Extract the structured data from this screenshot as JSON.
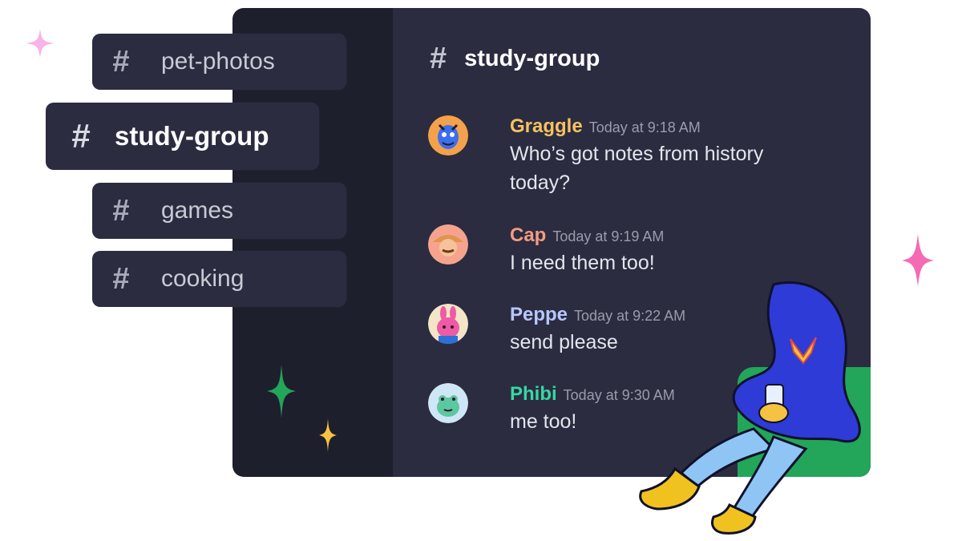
{
  "channels": [
    {
      "name": "pet-photos",
      "active": false
    },
    {
      "name": "study-group",
      "active": true
    },
    {
      "name": "games",
      "active": false
    },
    {
      "name": "cooking",
      "active": false
    }
  ],
  "header": {
    "channel": "study-group"
  },
  "messages": [
    {
      "author": "Graggle",
      "time": "Today at 9:18 AM",
      "text": "Who’s got notes from history today?",
      "color": "#f6c261"
    },
    {
      "author": "Cap",
      "time": "Today at 9:19 AM",
      "text": "I need them too!",
      "color": "#f39b84"
    },
    {
      "author": "Peppe",
      "time": "Today at 9:22 AM",
      "text": "send please",
      "color": "#b7c6ff"
    },
    {
      "author": "Phibi",
      "time": "Today at 9:30 AM",
      "text": "me too!",
      "color": "#39d6a3"
    }
  ],
  "icons": {
    "channel": "hash-icon",
    "decor": [
      "sparkle-icon",
      "character-illustration"
    ]
  },
  "colors": {
    "bg_dark": "#1e1f2d",
    "bg_chat": "#2b2c40",
    "green": "#23a55a",
    "yellow": "#f5c242",
    "pink": "#f472b6"
  }
}
